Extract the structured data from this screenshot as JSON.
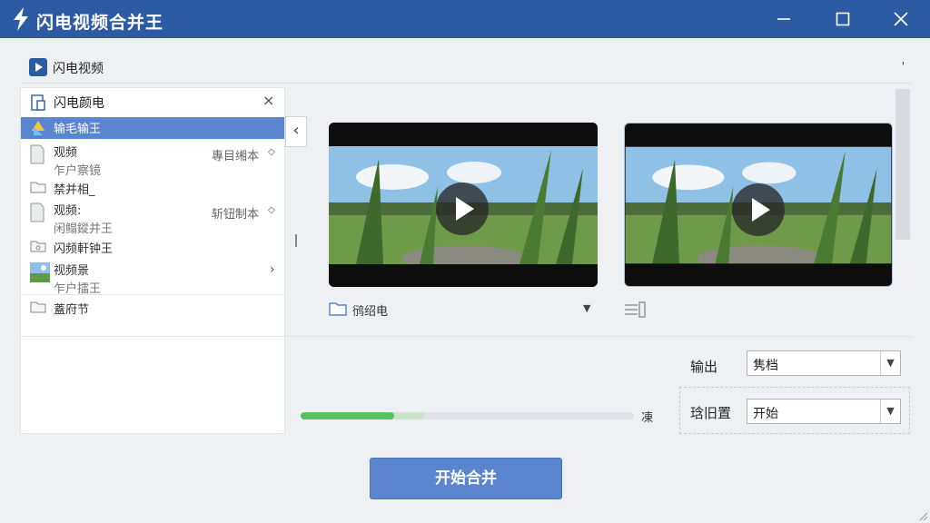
{
  "window": {
    "title": "闪电视频合并王",
    "controls": [
      "minimize",
      "maximize",
      "close"
    ]
  },
  "top_row": {
    "label": "闪电视频",
    "tick": "'"
  },
  "left_panel": {
    "header": "闪电颜电",
    "close": "×",
    "items": [
      {
        "icon": "app-icon",
        "title": "输毛输王",
        "selected": true
      },
      {
        "icon": "doc-icon",
        "title": "观频",
        "subtitle": "乍户察镜",
        "meta": "專目缃本",
        "marker": "◇"
      },
      {
        "icon": "folder-icon",
        "title": "禁并相_"
      },
      {
        "icon": "doc-icon",
        "title": "观频:",
        "subtitle": "闲鳎鏦并王",
        "meta": "斩钮制本",
        "marker": "◇"
      },
      {
        "icon": "image-folder-icon",
        "title": "闪频軒钟王"
      },
      {
        "icon": "thumbnail-icon",
        "title": "视频景",
        "subtitle": "乍户擂王",
        "chevron": "›"
      },
      {
        "icon": "folder-icon",
        "title": "蓋府节"
      }
    ]
  },
  "collapse_button": "‹",
  "videos": [
    {
      "name": "video-preview-1",
      "selected": false
    },
    {
      "name": "video-preview-2",
      "selected": true
    }
  ],
  "source": {
    "folder_label": "鸻绍电",
    "arrow": "▼"
  },
  "progress": {
    "fraction": 0.28,
    "buffer_fraction": 0.37,
    "label": "凍"
  },
  "output": {
    "label": "输出",
    "value": "隽档"
  },
  "position": {
    "label": "琀旧置",
    "value": "开始"
  },
  "start_button": "开始合并",
  "colors": {
    "titlebar": "#2d5ba3",
    "accent": "#5b86cf",
    "progress": "#5bbf62"
  }
}
